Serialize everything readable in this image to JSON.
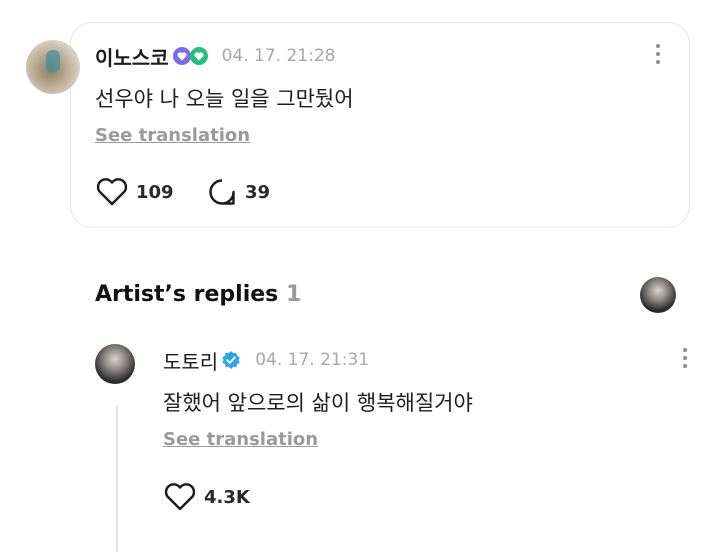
{
  "comment": {
    "username": "이노스코",
    "timestamp": "04. 17. 21:28",
    "text": "선우야 나 오늘 일을 그만뒀어",
    "see_translation": "See translation",
    "likes": "109",
    "replies": "39"
  },
  "artist_section": {
    "title": "Artist’s replies",
    "count": "1"
  },
  "reply": {
    "username": "도토리",
    "timestamp": "04. 17. 21:31",
    "text": "잘했어 앞으로의 삶이 행복해질거야",
    "see_translation": "See translation",
    "likes": "4.3K"
  },
  "colors": {
    "verified_blue": "#2aa7e8",
    "badge_purple": "#7a6cf0",
    "badge_green": "#22c07a"
  }
}
